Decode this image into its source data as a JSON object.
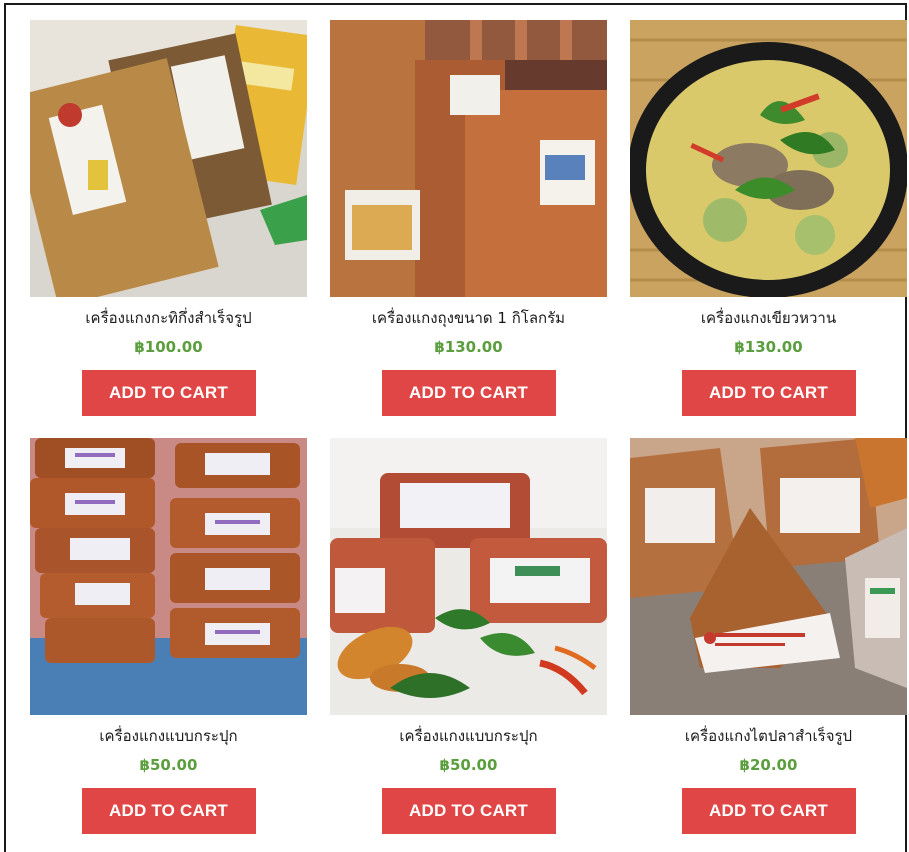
{
  "products": [
    {
      "name": "เครื่องแกงกะทิกึ่งสำเร็จรูป",
      "price": "฿100.00",
      "button": "ADD TO CART",
      "image_icon": "curry-paste-bags-image"
    },
    {
      "name": "เครื่องแกงถุงขนาด 1 กิโลกรัม",
      "price": "฿130.00",
      "button": "ADD TO CART",
      "image_icon": "curry-paste-kilo-bags-image"
    },
    {
      "name": "เครื่องแกงเขียวหวาน",
      "price": "฿130.00",
      "button": "ADD TO CART",
      "image_icon": "green-curry-bowl-image"
    },
    {
      "name": "เครื่องแกงแบบกระปุก",
      "price": "฿50.00",
      "button": "ADD TO CART",
      "image_icon": "curry-paste-tubs-image"
    },
    {
      "name": "เครื่องแกงแบบกระปุก",
      "price": "฿50.00",
      "button": "ADD TO CART",
      "image_icon": "curry-paste-tubs-with-herbs-image"
    },
    {
      "name": "เครื่องแกงไตปลาสำเร็จรูป",
      "price": "฿20.00",
      "button": "ADD TO CART",
      "image_icon": "fish-curry-paste-packs-image"
    }
  ],
  "colors": {
    "button": "#e04646",
    "price": "#5a9e3e"
  }
}
